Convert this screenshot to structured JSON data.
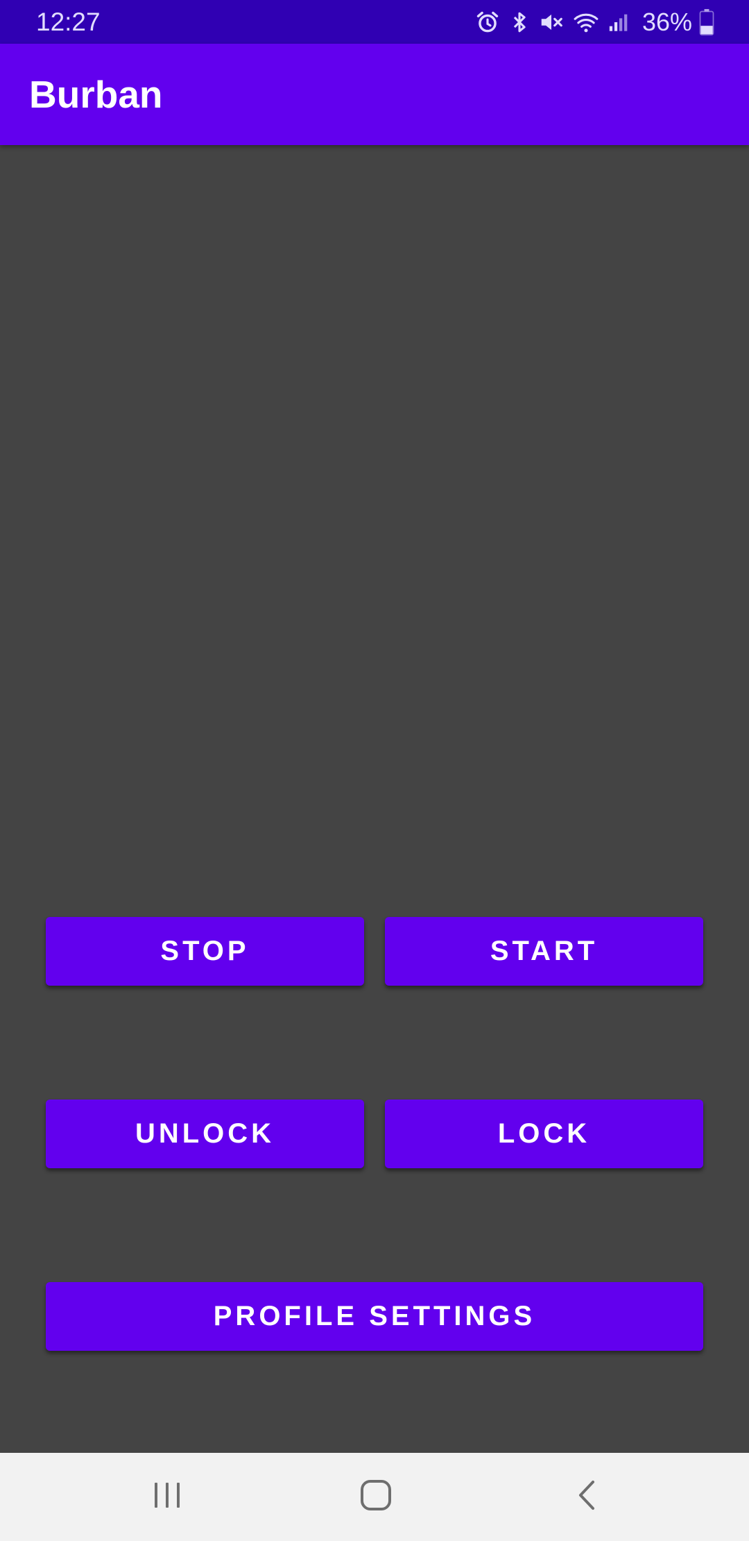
{
  "status_bar": {
    "time": "12:27",
    "battery_percent": "36%",
    "battery_level": 0.36,
    "icons": [
      "alarm-icon",
      "bluetooth-icon",
      "mute-icon",
      "wifi-icon",
      "signal-icon",
      "battery-icon"
    ],
    "background_color": "#3000b3"
  },
  "app_bar": {
    "title": "Burban",
    "background_color": "#6200ee"
  },
  "main": {
    "background_color": "#444444",
    "buttons": {
      "stop": "STOP",
      "start": "START",
      "unlock": "UNLOCK",
      "lock": "LOCK",
      "profile_settings": "PROFILE SETTINGS"
    },
    "button_color": "#6200ee"
  },
  "nav_bar": {
    "icons": [
      "recents-icon",
      "home-icon",
      "back-icon"
    ],
    "background_color": "#f2f2f2"
  }
}
